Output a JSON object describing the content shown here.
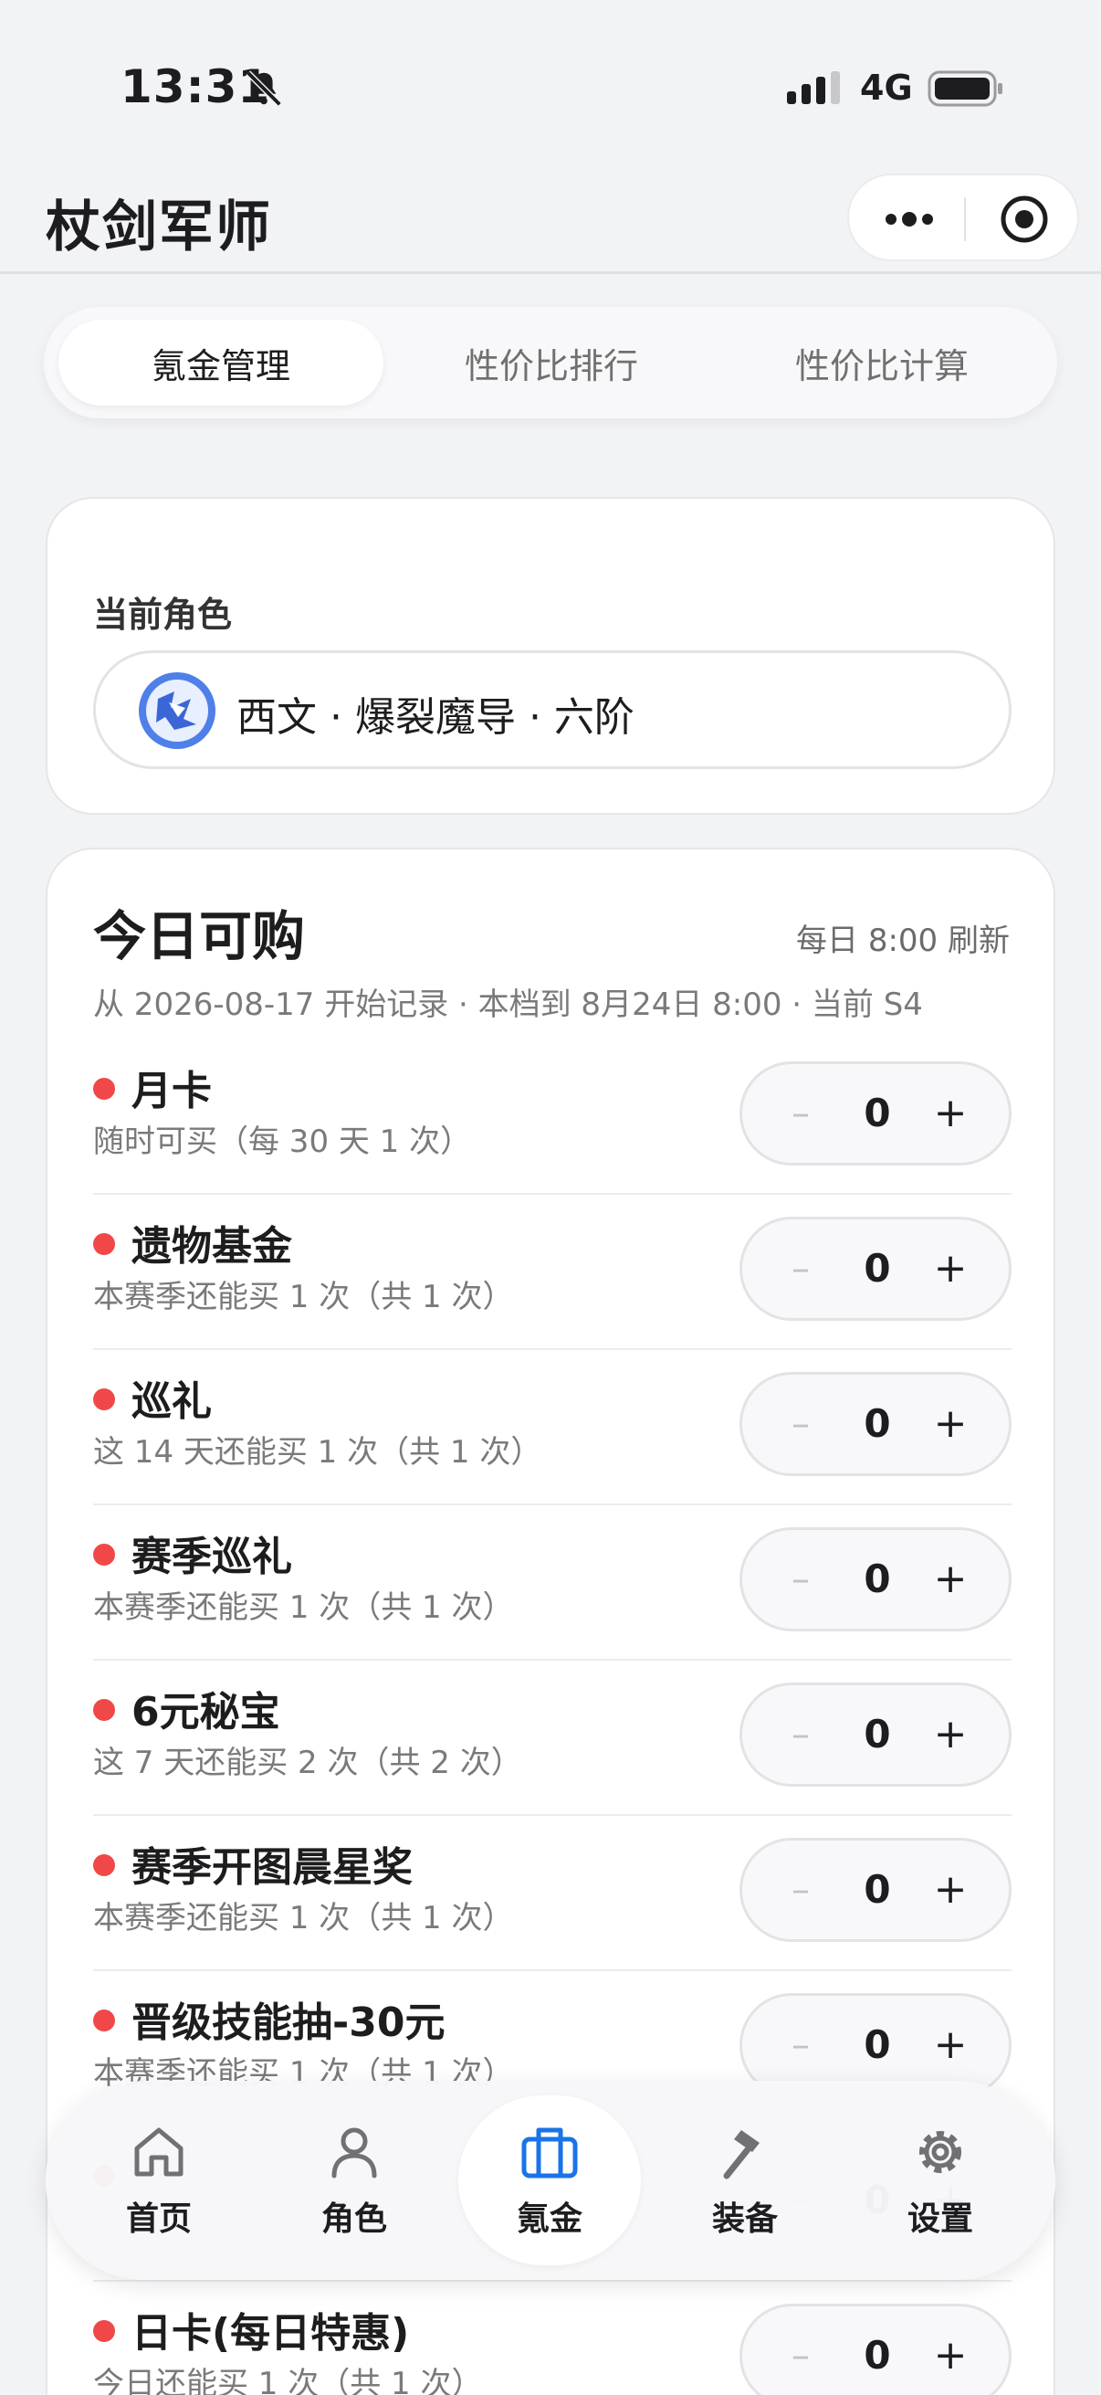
{
  "status_bar": {
    "time": "13:31",
    "network": "4G"
  },
  "nav": {
    "title": "杖剑军师"
  },
  "tabs": [
    {
      "label": "氪金管理",
      "active": true
    },
    {
      "label": "性价比排行",
      "active": false
    },
    {
      "label": "性价比计算",
      "active": false
    }
  ],
  "role": {
    "label": "当前角色",
    "name": "西文 · 爆裂魔导 · 六阶"
  },
  "buy": {
    "title": "今日可购",
    "refresh": "每日 8:00 刷新",
    "subtitle": "从 2026-08-17 开始记录 · 本档到 8月24日 8:00 · 当前 S4",
    "items": [
      {
        "name": "月卡",
        "desc": "随时可买（每 30 天 1 次）",
        "qty": "0"
      },
      {
        "name": "遗物基金",
        "desc": "本赛季还能买 1 次（共 1 次）",
        "qty": "0"
      },
      {
        "name": "巡礼",
        "desc": "这 14 天还能买 1 次（共 1 次）",
        "qty": "0"
      },
      {
        "name": "赛季巡礼",
        "desc": "本赛季还能买 1 次（共 1 次）",
        "qty": "0"
      },
      {
        "name": "6元秘宝",
        "desc": "这 7 天还能买 2 次（共 2 次）",
        "qty": "0"
      },
      {
        "name": "赛季开图晨星奖",
        "desc": "本赛季还能买 1 次（共 1 次）",
        "qty": "0"
      },
      {
        "name": "晋级技能抽-30元",
        "desc": "本赛季还能买 1 次（共 1 次）",
        "qty": "0"
      },
      {
        "name": "",
        "desc": "",
        "qty": "0"
      },
      {
        "name": "日卡(每日特惠)",
        "desc": "今日还能买 1 次（共 1 次）",
        "qty": "0"
      }
    ],
    "minus": "–",
    "plus": "+"
  },
  "tabbar": [
    {
      "label": "首页",
      "icon": "home-icon"
    },
    {
      "label": "角色",
      "icon": "person-icon"
    },
    {
      "label": "氪金",
      "icon": "wallet-icon",
      "active": true
    },
    {
      "label": "装备",
      "icon": "hammer-icon"
    },
    {
      "label": "设置",
      "icon": "gear-icon"
    }
  ],
  "colors": {
    "accent": "#1a73e8",
    "dot": "#f04848"
  }
}
